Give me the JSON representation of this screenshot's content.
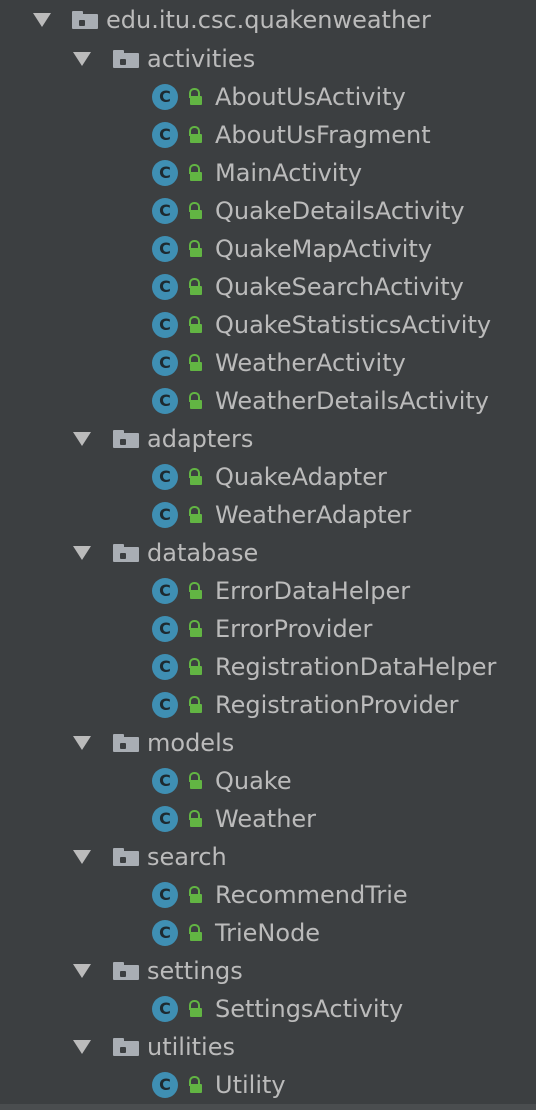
{
  "tree": {
    "root": {
      "label": "edu.itu.csc.quakenweather",
      "expanded": true
    },
    "packages": [
      {
        "label": "activities",
        "classes": [
          "AboutUsActivity",
          "AboutUsFragment",
          "MainActivity",
          "QuakeDetailsActivity",
          "QuakeMapActivity",
          "QuakeSearchActivity",
          "QuakeStatisticsActivity",
          "WeatherActivity",
          "WeatherDetailsActivity"
        ]
      },
      {
        "label": "adapters",
        "classes": [
          "QuakeAdapter",
          "WeatherAdapter"
        ]
      },
      {
        "label": "database",
        "classes": [
          "ErrorDataHelper",
          "ErrorProvider",
          "RegistrationDataHelper",
          "RegistrationProvider"
        ]
      },
      {
        "label": "models",
        "classes": [
          "Quake",
          "Weather"
        ]
      },
      {
        "label": "search",
        "classes": [
          "RecommendTrie",
          "TrieNode"
        ]
      },
      {
        "label": "settings",
        "classes": [
          "SettingsActivity"
        ]
      },
      {
        "label": "utilities",
        "classes": [
          "Utility"
        ]
      }
    ]
  },
  "icons": {
    "class_glyph": "C",
    "class_icon_color": "#3f8fb3",
    "lock_icon_color": "#62b543",
    "folder_icon_color": "#a9aeb4",
    "expand_arrow": "chevron-down-icon"
  },
  "theme": {
    "background": "#3c3f41",
    "text": "#bbbbbb"
  }
}
